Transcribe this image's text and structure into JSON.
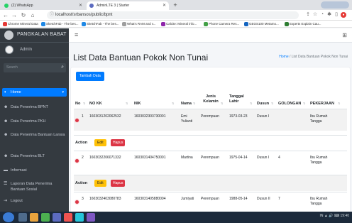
{
  "browser": {
    "tabs": [
      {
        "title": "(2) WhatsApp",
        "icon": "whatsapp-icon",
        "color": "#25d366"
      },
      {
        "title": "AdminLTE 3 | Starter",
        "icon": "adminlte-icon",
        "color": "#5c6bc0"
      }
    ],
    "new_tab": "+",
    "url": "localhost/srbansos/public/bpnt",
    "bookmarks": [
      {
        "label": "Chrome Mineral Data",
        "color": "#e53935"
      },
      {
        "label": "SketchFab - The bes...",
        "color": "#1e88e5"
      },
      {
        "label": "SketchFab - The bes...",
        "color": "#1e88e5"
      },
      {
        "label": "What's RAM and v...",
        "color": "#9e9e9e"
      },
      {
        "label": "Calcite: Mineral info...",
        "color": "#8e24aa"
      },
      {
        "label": "Phone Camera Res...",
        "color": "#43a047"
      },
      {
        "label": "GEOS100 Metamo...",
        "color": "#1565c0"
      },
      {
        "label": "Experts Explain Cau...",
        "color": "#2e7d32"
      }
    ]
  },
  "sidebar": {
    "brand": "PANGKALAN BABAT",
    "user": "Admin",
    "search_placeholder": "Search",
    "items": [
      {
        "label": "Home",
        "icon": "dashboard-icon",
        "active": true
      },
      {
        "label": "Data Penerima BPNT",
        "icon": "users-icon"
      },
      {
        "label": "Data Penerima PKH",
        "icon": "users-icon"
      },
      {
        "label": "Data Penerima Bantuan Lansia",
        "icon": "users-icon"
      },
      {
        "label": "Data Penerima BLT",
        "icon": "users-icon"
      },
      {
        "label": "Informasi",
        "icon": "folder-icon"
      },
      {
        "label": "Laporan Data Penerima Bantuan Sosial",
        "icon": "list-icon"
      },
      {
        "label": "Logout",
        "icon": "logout-icon"
      }
    ]
  },
  "page": {
    "title": "List Data Bantuan Pokok Non Tunai",
    "breadcrumb_home": "Home",
    "breadcrumb_sep": "/",
    "breadcrumb_current": "List Data Bantuan Pokok Non Tunai",
    "add_button": "Tambah Data"
  },
  "table": {
    "headers": {
      "no": "No",
      "nokk": "NO KK",
      "nik": "NIK",
      "nama": "Nama",
      "jk": "Jenis Kelamin",
      "tgl": "Tanggal Lahir",
      "dusun": "Dusun",
      "gol": "GOLONGAN",
      "pekerjaan": "PEKERJAAN"
    },
    "action_label": "Action",
    "edit_label": "Edit",
    "delete_label": "Hapus",
    "rows": [
      {
        "no": "1",
        "nokk": "1603031202062532",
        "nik": "1603032303730001",
        "nama": "Emi Yulianti",
        "jk": "Perempuan",
        "tgl": "1973-03-23",
        "dusun": "Dusun I",
        "gol": "",
        "pekerjaan": "Ibu Rumah Tangga"
      },
      {
        "no": "2",
        "nokk": "1603032206071332",
        "nik": "1603031404750001",
        "nama": "Martina",
        "jk": "Perempuan",
        "tgl": "1975-04-14",
        "dusun": "Dusun I",
        "gol": "4",
        "pekerjaan": "Ibu Rumah Tangga"
      },
      {
        "no": "3",
        "nokk": "1603032403080783",
        "nik": "1603031405880004",
        "nama": "Jumiyati",
        "jk": "Perempuan",
        "tgl": "1988-05-14",
        "dusun": "Dusun II",
        "gol": "7",
        "pekerjaan": "Ibu Rumah Tangga"
      }
    ]
  },
  "taskbar": {
    "tray_text": "IN ▲ 🔊 ⌨ 19:40"
  }
}
